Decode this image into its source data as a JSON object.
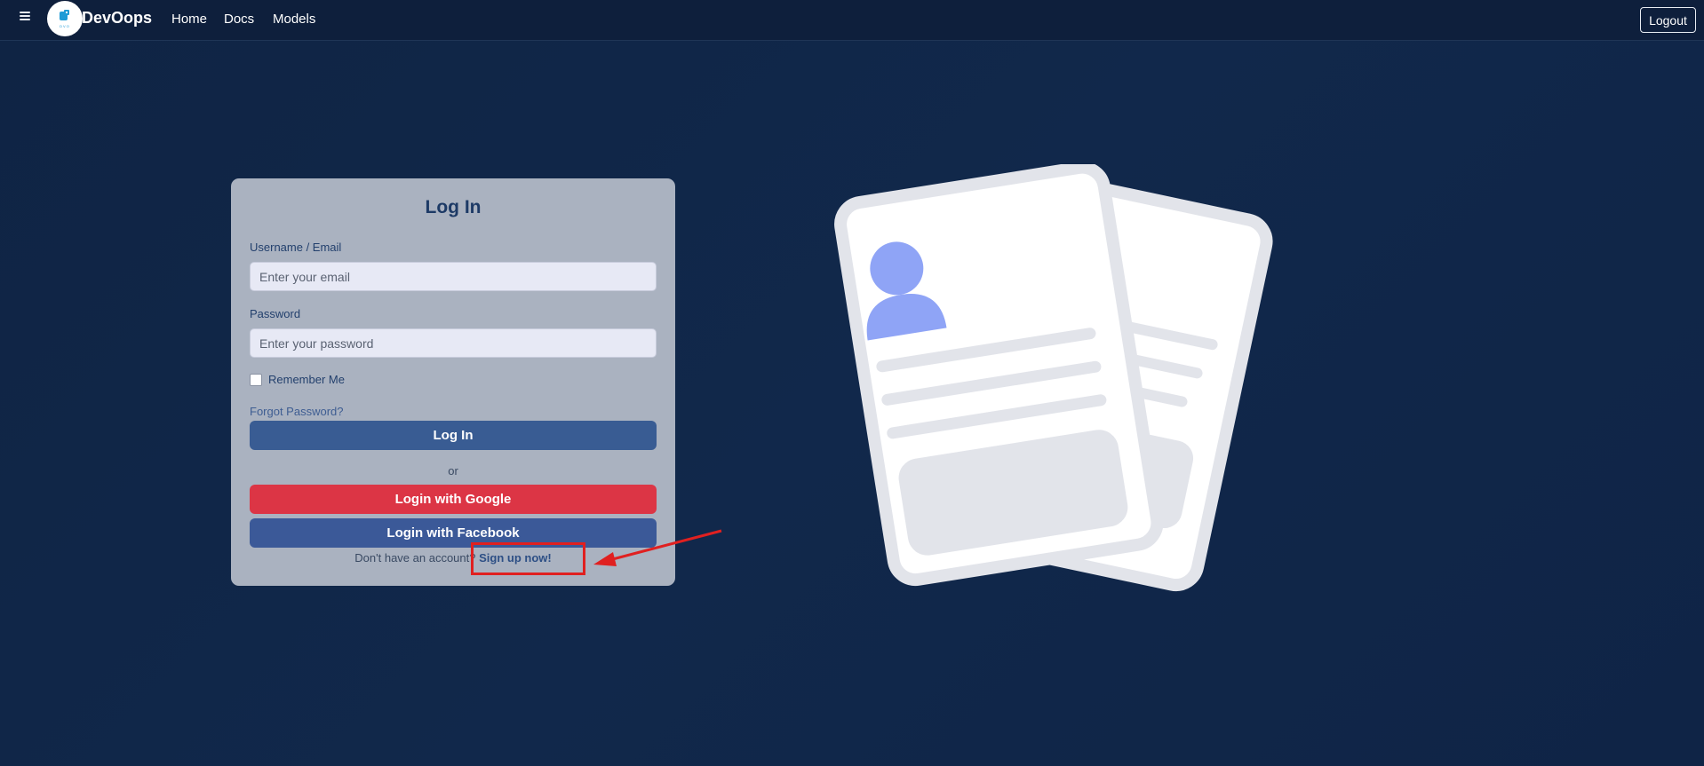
{
  "nav": {
    "brand": "DevOops",
    "links": [
      "Home",
      "Docs",
      "Models"
    ],
    "logout": "Logout"
  },
  "login": {
    "title": "Log In",
    "username_label": "Username / Email",
    "username_placeholder": "Enter your email",
    "password_label": "Password",
    "password_placeholder": "Enter your password",
    "remember_label": "Remember Me",
    "forgot_label": "Forgot Password?",
    "login_button": "Log In",
    "or_text": "or",
    "google_button": "Login with Google",
    "facebook_button": "Login with Facebook",
    "signup_prompt": "Don't have an account? ",
    "signup_link": "Sign up now!"
  },
  "colors": {
    "background": "#0f2444",
    "card": "#aab2c0",
    "primary": "#395c93",
    "google": "#dc3545",
    "facebook": "#3b5998",
    "annotation": "#e02020",
    "avatar": "#8fa4f6"
  },
  "icons": [
    "hamburger-icon",
    "logo-icon",
    "document-profile-illustration"
  ]
}
